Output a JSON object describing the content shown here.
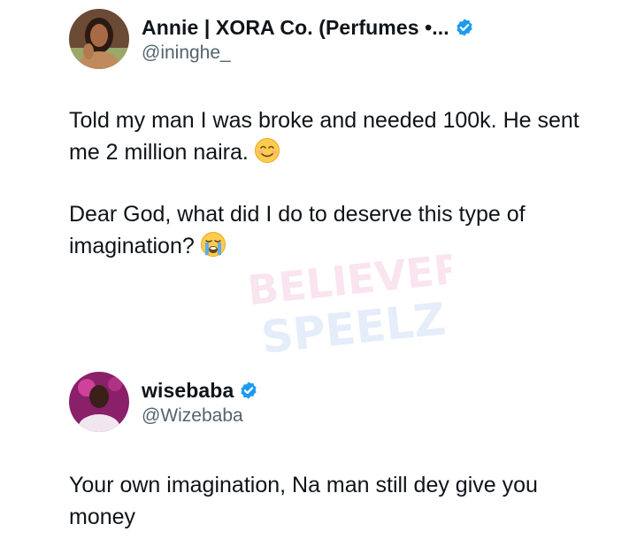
{
  "tweets": [
    {
      "author": {
        "display_name": "Annie | XORA Co. (Perfumes •...",
        "handle": "@ininghe_",
        "verified": true,
        "avatar_icon": "profile-photo-woman"
      },
      "paragraphs": [
        {
          "text": "Told my man I was broke and needed 100k. He sent me 2 million naira.",
          "emoji": "smiling-face-icon"
        },
        {
          "text": "Dear God, what did I do to deserve this type of imagination?",
          "emoji": "crying-face-icon"
        }
      ]
    },
    {
      "author": {
        "display_name": "wisebaba",
        "handle": "@Wizebaba",
        "verified": true,
        "avatar_icon": "profile-photo-man"
      },
      "paragraphs": [
        {
          "text": "Your own imagination, Na man still dey give you money"
        }
      ]
    }
  ],
  "watermark": {
    "line1": "BELIEVER",
    "line2": "SPEELZ"
  },
  "colors": {
    "verified_blue": "#1d9bf0",
    "handle_gray": "#536471",
    "text": "#0f1419"
  }
}
